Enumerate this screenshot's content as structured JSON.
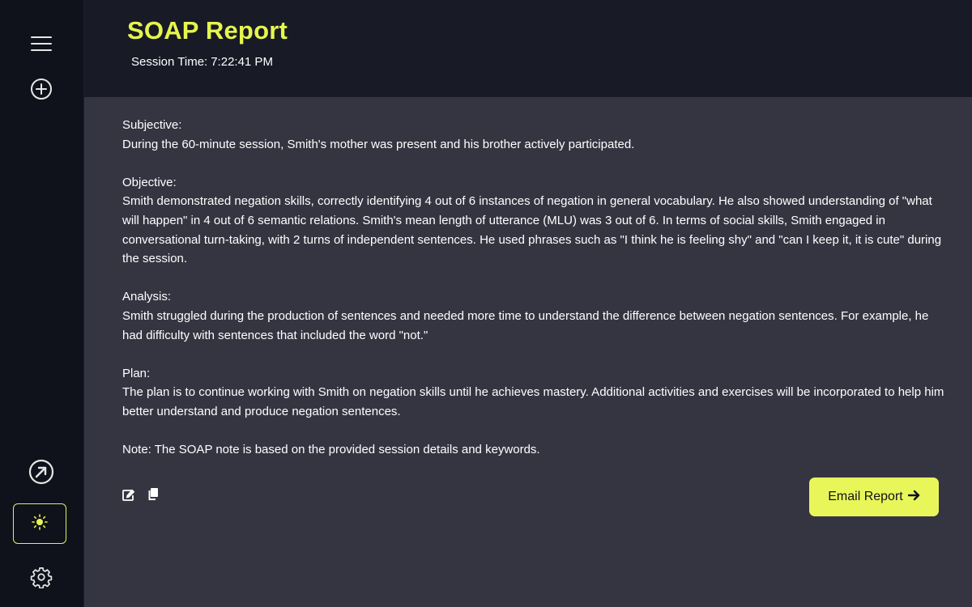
{
  "sidebar": {
    "icons": [
      "menu-icon",
      "plus-circle-icon",
      "external-link-icon",
      "sun-icon",
      "gear-icon"
    ],
    "accent": "#dff35a"
  },
  "header": {
    "title": "SOAP Report",
    "session_label": "Session Time:",
    "session_time": "7:22:41 PM"
  },
  "report": {
    "subjective": {
      "heading": "Subjective:",
      "text": "During the 60-minute session, Smith's mother was present and his brother actively participated."
    },
    "objective": {
      "heading": "Objective:",
      "text": "Smith demonstrated negation skills, correctly identifying 4 out of 6 instances of negation in general vocabulary. He also showed understanding of \"what will happen\" in 4 out of 6 semantic relations. Smith's mean length of utterance (MLU) was 3 out of 6. In terms of social skills, Smith engaged in conversational turn-taking, with 2 turns of independent sentences. He used phrases such as \"I think he is feeling shy\" and \"can I keep it, it is cute\" during the session."
    },
    "analysis": {
      "heading": "Analysis:",
      "text": "Smith struggled during the production of sentences and needed more time to understand the difference between negation sentences. For example, he had difficulty with sentences that included the word \"not.\""
    },
    "plan": {
      "heading": "Plan:",
      "text": "The plan is to continue working with Smith on negation skills until he achieves mastery. Additional activities and exercises will be incorporated to help him better understand and produce negation sentences."
    },
    "note": "Note: The SOAP note is based on the provided session details and keywords."
  },
  "actions": {
    "edit_icon": "edit-icon",
    "copy_icon": "copy-icon",
    "email_label": "Email Report",
    "email_icon": "arrow-right-icon"
  },
  "colors": {
    "accent": "#e5f54d",
    "button_bg": "#e8f65a",
    "header_bg": "#181a26",
    "content_bg": "#353542",
    "sidebar_bg": "#0f111b"
  }
}
